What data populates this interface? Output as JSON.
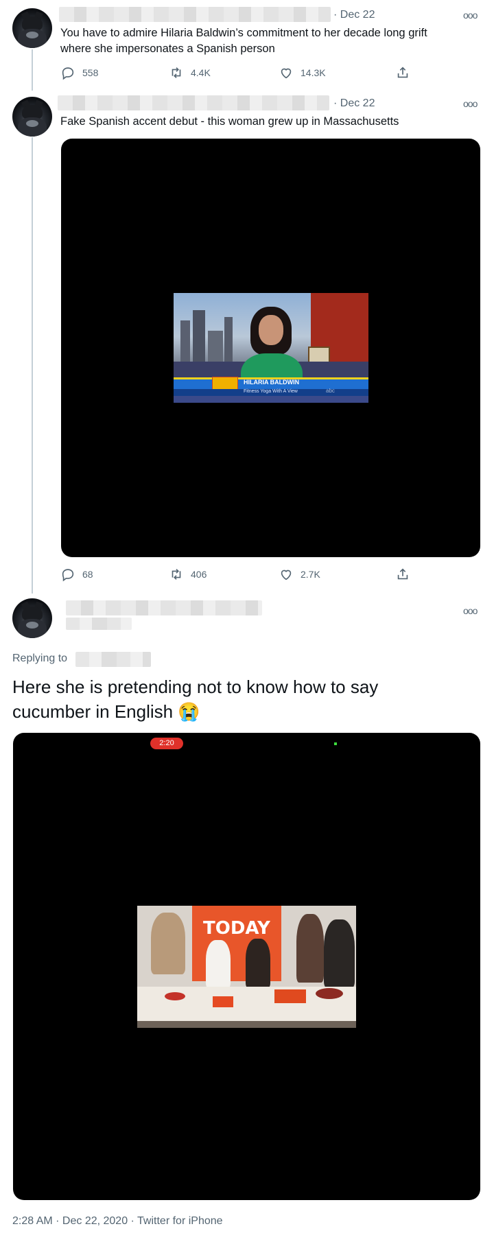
{
  "tweets": [
    {
      "date": "· Dec 22",
      "text_line1": "You have to admire Hilaria Baldwin’s commitment to her decade long grift",
      "text_line2": "where she impersonates a Spanish person",
      "replies": "558",
      "retweets": "4.4K",
      "likes": "14.3K"
    },
    {
      "date": "· Dec 22",
      "text_line1": "Fake Spanish accent debut - this woman grew up in Massachusetts",
      "replies": "68",
      "retweets": "406",
      "likes": "2.7K",
      "thumb_caption": "HILARIA BALDWIN",
      "thumb_subcaption": "Fitness Yoga With A View",
      "thumb_badge": "abc"
    }
  ],
  "main_tweet": {
    "replying_label": "Replying to",
    "text_line1": "Here she is pretending not to know how to say",
    "text_line2": "cucumber in English",
    "emoji": "😭",
    "video_time": "2:20",
    "video_logo": "TODAY",
    "footer": "2:28 AM · Dec 22, 2020 · Twitter for iPhone"
  },
  "icons": {
    "more": "more-icon",
    "reply": "reply-icon",
    "retweet": "retweet-icon",
    "like": "like-icon",
    "share": "share-icon"
  }
}
